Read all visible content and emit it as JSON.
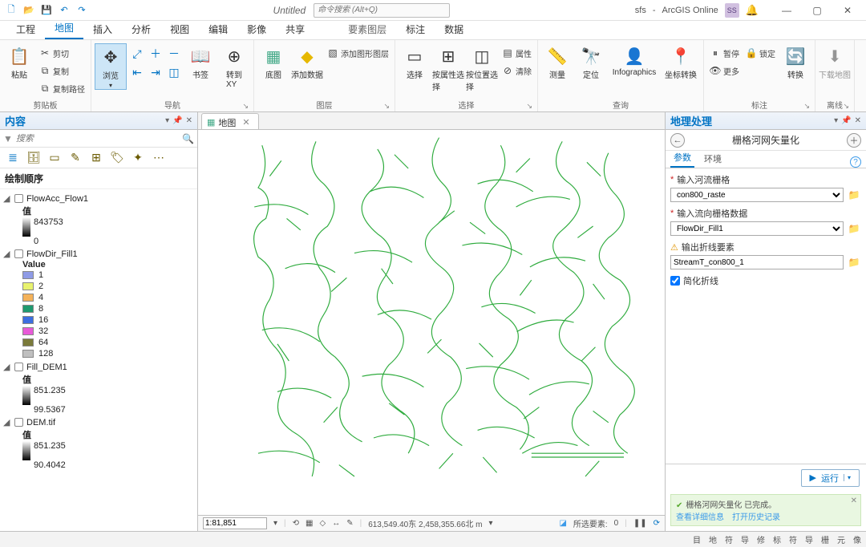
{
  "title": {
    "doc": "Untitled",
    "search_ph": "命令搜索 (Alt+Q)",
    "user": "sfs",
    "signin": "ArcGIS Online",
    "avatar": "SS"
  },
  "tabs": {
    "main": [
      "工程",
      "地图",
      "插入",
      "分析",
      "视图",
      "编辑",
      "影像",
      "共享"
    ],
    "ctx": [
      "要素图层",
      "标注",
      "数据"
    ],
    "active": 1
  },
  "ribbon": {
    "clipboard": {
      "paste": "粘贴",
      "cut": "剪切",
      "copy": "复制",
      "copypath": "复制路径",
      "label": "剪贴板"
    },
    "nav": {
      "browse": "浏览",
      "bookmark": "书签",
      "goto": "转到\nXY",
      "label": "导航"
    },
    "layer": {
      "basemap": "底图",
      "adddata": "添加数据",
      "addgraphics": "添加图形图层",
      "label": "图层"
    },
    "select": {
      "select": "选择",
      "byattr": "按属性选择",
      "byloc": "按位置选择",
      "attr": "属性",
      "clear": "清除",
      "label": "选择"
    },
    "query": {
      "measure": "测量",
      "locate": "定位",
      "info": "Infographics",
      "coord": "坐标转换",
      "label": "查询"
    },
    "annot": {
      "pause": "暂停",
      "lock": "锁定",
      "more": "更多",
      "convert": "转换",
      "label": "标注"
    },
    "offline": {
      "download": "下载地图",
      "label": "离线"
    }
  },
  "contents": {
    "title": "内容",
    "search_ph": "搜索",
    "section": "绘制顺序",
    "layers": [
      {
        "name": "FlowAcc_Flow1",
        "type": "stretch",
        "head": "值",
        "hi": "843753",
        "lo": "0"
      },
      {
        "name": "FlowDir_Fill1",
        "type": "unique",
        "head": "Value",
        "classes": [
          {
            "c": "#8f9be6",
            "v": "1"
          },
          {
            "c": "#e8f26e",
            "v": "2"
          },
          {
            "c": "#f4b25a",
            "v": "4"
          },
          {
            "c": "#1f9a6f",
            "v": "8"
          },
          {
            "c": "#3d6fe0",
            "v": "16"
          },
          {
            "c": "#e85ad8",
            "v": "32"
          },
          {
            "c": "#7a7a3a",
            "v": "64"
          },
          {
            "c": "#bfbfbf",
            "v": "128"
          }
        ]
      },
      {
        "name": "Fill_DEM1",
        "type": "stretch",
        "head": "值",
        "hi": "851.235",
        "lo": "99.5367"
      },
      {
        "name": "DEM.tif",
        "type": "stretch",
        "head": "值",
        "hi": "851.235",
        "lo": "90.4042"
      }
    ]
  },
  "map": {
    "tab": "地图",
    "scale": "1:81,851",
    "coords": "613,549.40东 2,458,355.66北 m",
    "sel_label": "所选要素:",
    "sel_count": "0"
  },
  "gp": {
    "title": "地理处理",
    "tool": "栅格河网矢量化",
    "tabs": {
      "params": "参数",
      "env": "环境"
    },
    "f1": {
      "lab": "输入河流栅格",
      "val": "con800_raste"
    },
    "f2": {
      "lab": "输入流向栅格数据",
      "val": "FlowDir_Fill1"
    },
    "f3": {
      "lab": "输出折线要素",
      "val": "StreamT_con800_1"
    },
    "chk": "简化折线",
    "run": "运行",
    "msg": {
      "title": "栅格河网矢量化 已完成。",
      "l1": "查看详细信息",
      "l2": "打开历史记录"
    }
  },
  "status": {
    "items": [
      "目",
      "地",
      "符",
      "导",
      "修",
      "标",
      "符",
      "导",
      "栅",
      "元",
      "像"
    ]
  }
}
